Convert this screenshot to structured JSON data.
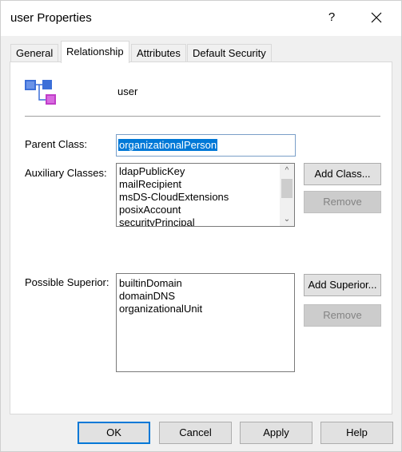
{
  "window": {
    "title": "user Properties",
    "help_glyph": "?",
    "close_icon": "close-icon"
  },
  "tabs": [
    {
      "label": "General",
      "active": false
    },
    {
      "label": "Relationship",
      "active": true
    },
    {
      "label": "Attributes",
      "active": false
    },
    {
      "label": "Default Security",
      "active": false
    }
  ],
  "relationship": {
    "class_name": "user",
    "parent_class_label": "Parent Class:",
    "parent_class_value": "organizationalPerson",
    "auxiliary_label": "Auxiliary Classes:",
    "auxiliary_items": [
      "ldapPublicKey",
      "mailRecipient",
      "msDS-CloudExtensions",
      "posixAccount",
      "securityPrincipal"
    ],
    "add_class_label": "Add Class...",
    "remove_aux_label": "Remove",
    "superior_label": "Possible Superior:",
    "superior_items": [
      "builtinDomain",
      "domainDNS",
      "organizationalUnit"
    ],
    "add_superior_label": "Add Superior...",
    "remove_sup_label": "Remove"
  },
  "footer": {
    "ok_label": "OK",
    "cancel_label": "Cancel",
    "apply_label": "Apply",
    "help_label": "Help"
  },
  "colors": {
    "accent": "#0078d7",
    "icon_blue": "#3c6fd8",
    "icon_purple": "#c03ec8"
  }
}
